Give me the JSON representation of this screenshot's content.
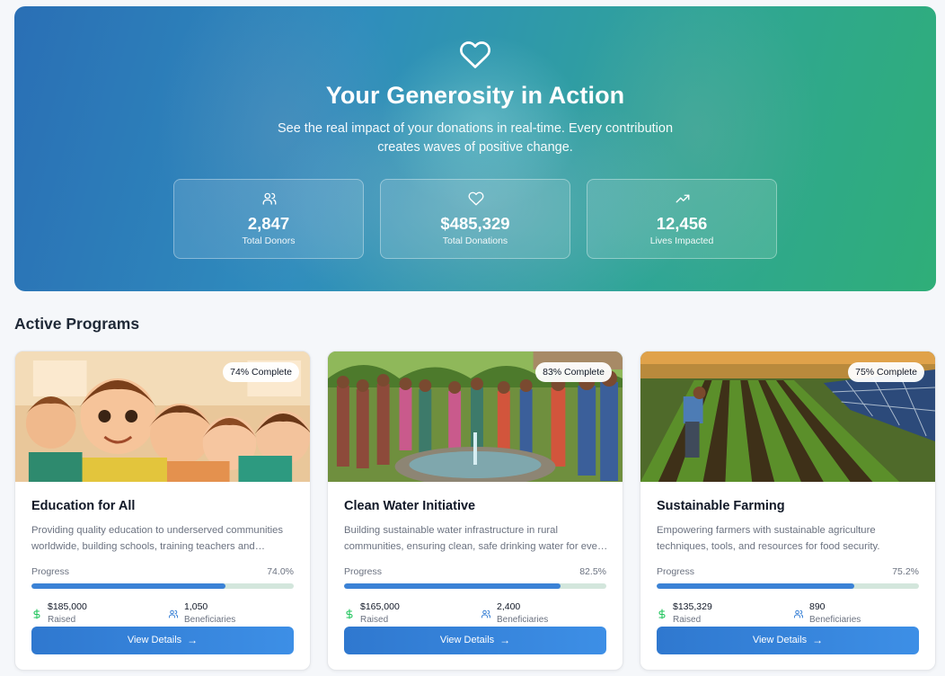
{
  "hero": {
    "title": "Your Generosity in Action",
    "subtitle": "See the real impact of your donations in real-time. Every contribution creates waves of positive change.",
    "icon": "heart-icon",
    "stats": [
      {
        "icon": "users-icon",
        "value": "2,847",
        "label": "Total Donors"
      },
      {
        "icon": "heart-icon",
        "value": "$485,329",
        "label": "Total Donations"
      },
      {
        "icon": "trending-up-icon",
        "value": "12,456",
        "label": "Lives Impacted"
      }
    ]
  },
  "section_title": "Active Programs",
  "colors": {
    "accent": "#3b82d6",
    "raised_icon": "#22c55e",
    "beneficiary_icon": "#3b82d6",
    "track": "#d3e6dc"
  },
  "programs": [
    {
      "badge": "74% Complete",
      "title": "Education for All",
      "description": "Providing quality education to underserved communities worldwide, building schools, training teachers and supplying materials.",
      "progress_label": "Progress",
      "progress_text": "74.0%",
      "progress": 74.0,
      "raised": "$185,000",
      "raised_label": "Raised",
      "beneficiaries": "1,050",
      "beneficiaries_label": "Beneficiaries",
      "button": "View Details"
    },
    {
      "badge": "83% Complete",
      "title": "Clean Water Initiative",
      "description": "Building sustainable water infrastructure in rural communities, ensuring clean, safe drinking water for every family.",
      "progress_label": "Progress",
      "progress_text": "82.5%",
      "progress": 82.5,
      "raised": "$165,000",
      "raised_label": "Raised",
      "beneficiaries": "2,400",
      "beneficiaries_label": "Beneficiaries",
      "button": "View Details"
    },
    {
      "badge": "75% Complete",
      "title": "Sustainable Farming",
      "description": "Empowering farmers with sustainable agriculture techniques, tools, and resources for food security.",
      "progress_label": "Progress",
      "progress_text": "75.2%",
      "progress": 75.2,
      "raised": "$135,329",
      "raised_label": "Raised",
      "beneficiaries": "890",
      "beneficiaries_label": "Beneficiaries",
      "button": "View Details"
    }
  ]
}
